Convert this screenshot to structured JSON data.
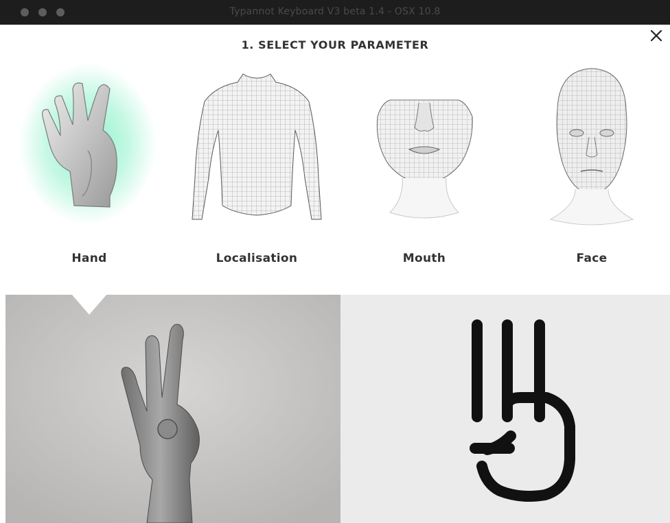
{
  "window": {
    "title": "Typannot Keyboard V3 beta 1.4 - OSX 10.8"
  },
  "heading": "1. SELECT YOUR PARAMETER",
  "close_icon": "close-icon",
  "parameters": [
    {
      "label": "Hand",
      "selected": true,
      "highlight_color": "#7ff0c4"
    },
    {
      "label": "Localisation",
      "selected": false
    },
    {
      "label": "Mouth",
      "selected": false
    },
    {
      "label": "Face",
      "selected": false
    }
  ],
  "preview": {
    "photo": "hand-photo",
    "glyph": "handshape-glyph-icon"
  }
}
